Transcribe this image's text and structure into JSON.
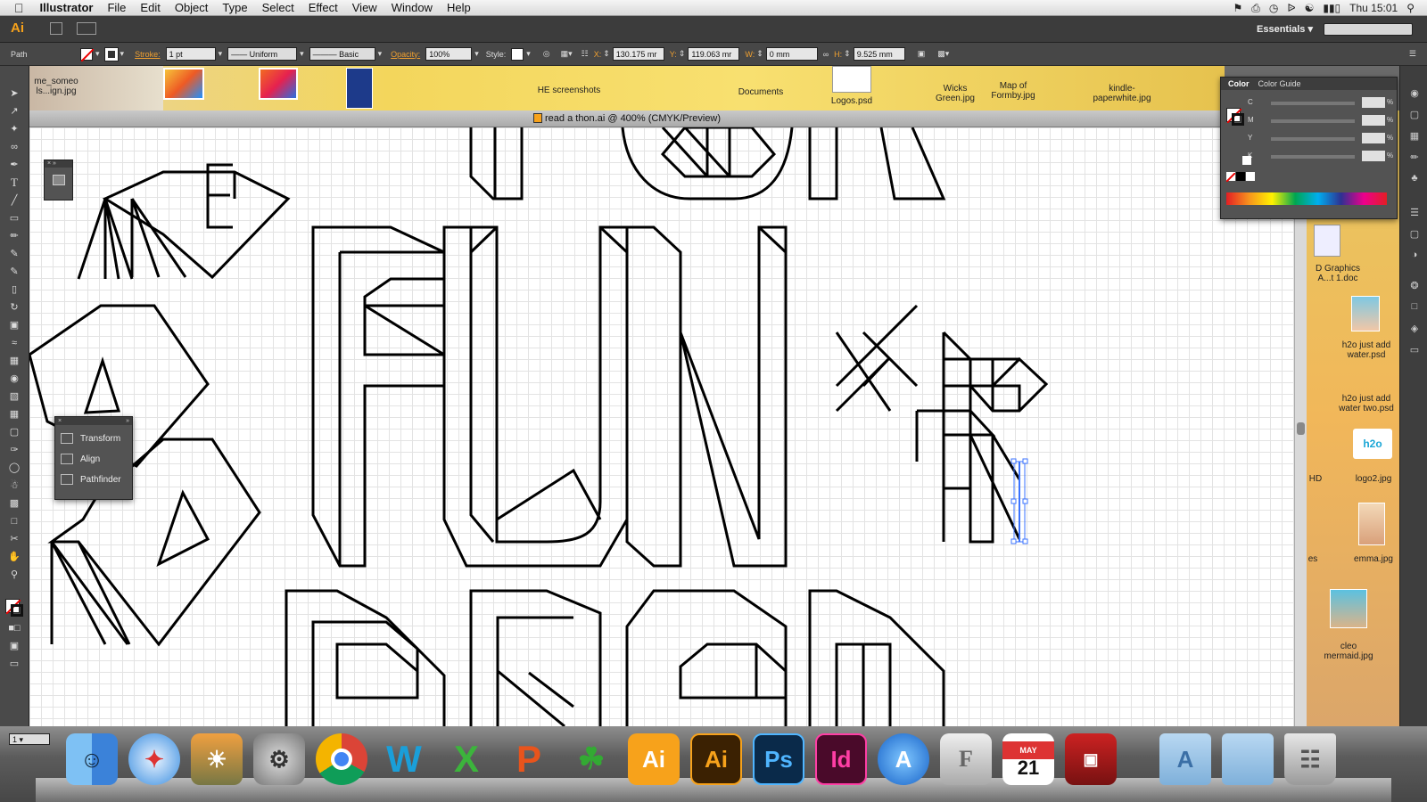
{
  "menubar": {
    "app_name": "Illustrator",
    "items": [
      "File",
      "Edit",
      "Object",
      "Type",
      "Select",
      "Effect",
      "View",
      "Window",
      "Help"
    ],
    "clock": "Thu 15:01"
  },
  "appbar": {
    "logo": "Ai",
    "workspace": "Essentials"
  },
  "control_bar": {
    "selection_type": "Path",
    "stroke_label": "Stroke:",
    "stroke_value": "1 pt",
    "profile": "Uniform",
    "brush": "Basic",
    "opacity_label": "Opacity:",
    "opacity_value": "100%",
    "style_label": "Style:",
    "x_label": "X:",
    "x_value": "130.175 mr",
    "y_label": "Y:",
    "y_value": "119.063 mr",
    "w_label": "W:",
    "w_value": "0 mm",
    "h_label": "H:",
    "h_value": "9.525 mm"
  },
  "desktop_strip": {
    "items": [
      "me_someo ls...ign.jpg",
      "HE screenshots",
      "Documents",
      "Logos.psd",
      "Wicks Green.jpg",
      "Map of Formby.jpg",
      "kindle-paperwhite.jpg"
    ]
  },
  "document": {
    "tab_title": "read a thon.ai @ 400% (CMYK/Preview)",
    "zoom": "1"
  },
  "artwork": {
    "fun_text": "FUN",
    "letter_e": "E"
  },
  "color_panel": {
    "tabs": [
      "Color",
      "Color Guide"
    ],
    "channels": [
      "C",
      "M",
      "Y",
      "K"
    ],
    "unit": "%"
  },
  "mini_panel": {
    "items": [
      "Transform",
      "Align",
      "Pathfinder"
    ]
  },
  "right_desktop": {
    "items": [
      "D Graphics A...t 1.doc",
      "h2o just add water.psd",
      "h2o just add water two.psd",
      "HD",
      "logo2.jpg",
      "es",
      "emma.jpg",
      "cleo mermaid.jpg"
    ]
  },
  "dock": {
    "apps": [
      "Finder",
      "Safari",
      "iPhoto",
      "System Preferences",
      "Chrome",
      "Word",
      "Excel",
      "PowerPoint",
      "Frogger",
      "Illustrator",
      "Illustrator CS6",
      "Photoshop",
      "InDesign",
      "App Store",
      "Font Book",
      "Calendar",
      "Photo Booth",
      "Applications",
      "Documents",
      "Trash"
    ],
    "calendar_month": "MAY",
    "calendar_day": "21"
  },
  "colors": {
    "accent": "#f7a21b",
    "panel_bg": "#535353"
  }
}
